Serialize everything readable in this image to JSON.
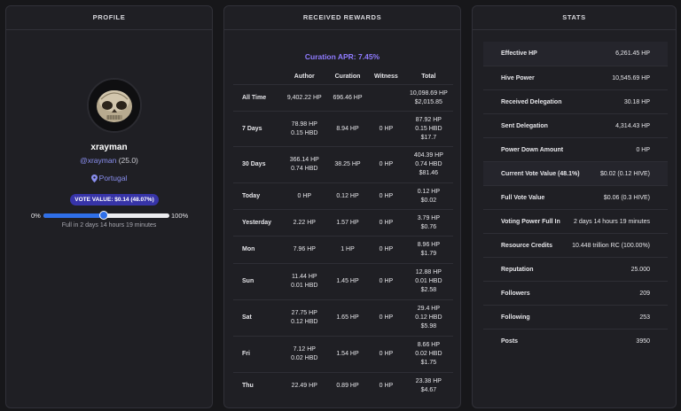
{
  "profile": {
    "header": "PROFILE",
    "username": "xrayman",
    "handle": "@xrayman",
    "reputation": "(25.0)",
    "location": "Portugal",
    "vote_value": "VOTE VALUE: $0.14 (48.07%)",
    "slider_min": "0%",
    "slider_max": "100%",
    "slider_fraction": 0.48,
    "full_in": "Full in 2 days 14 hours 19 minutes"
  },
  "rewards": {
    "header": "RECEIVED REWARDS",
    "curation_apr": "Curation APR: 7.45%",
    "columns": [
      "Author",
      "Curation",
      "Witness",
      "Total"
    ],
    "rows": [
      {
        "label": "All Time",
        "author": [
          "9,402.22 HP"
        ],
        "curation": "696.46 HP",
        "witness": "",
        "total": [
          "10,098.69 HP",
          "$2,015.85"
        ]
      },
      {
        "label": "7 Days",
        "author": [
          "78.98 HP",
          "0.15 HBD"
        ],
        "curation": "8.94 HP",
        "witness": "0 HP",
        "total": [
          "87.92 HP",
          "0.15 HBD",
          "$17.7"
        ]
      },
      {
        "label": "30 Days",
        "author": [
          "366.14 HP",
          "0.74 HBD"
        ],
        "curation": "38.25 HP",
        "witness": "0 HP",
        "total": [
          "404.39 HP",
          "0.74 HBD",
          "$81.46"
        ]
      },
      {
        "label": "Today",
        "author": [
          "0 HP"
        ],
        "curation": "0.12 HP",
        "witness": "0 HP",
        "total": [
          "0.12 HP",
          "$0.02"
        ]
      },
      {
        "label": "Yesterday",
        "author": [
          "2.22 HP"
        ],
        "curation": "1.57 HP",
        "witness": "0 HP",
        "total": [
          "3.79 HP",
          "$0.76"
        ]
      },
      {
        "label": "Mon",
        "author": [
          "7.96 HP"
        ],
        "curation": "1 HP",
        "witness": "0 HP",
        "total": [
          "8.96 HP",
          "$1.79"
        ]
      },
      {
        "label": "Sun",
        "author": [
          "11.44 HP",
          "0.01 HBD"
        ],
        "curation": "1.45 HP",
        "witness": "0 HP",
        "total": [
          "12.88 HP",
          "0.01 HBD",
          "$2.58"
        ]
      },
      {
        "label": "Sat",
        "author": [
          "27.75 HP",
          "0.12 HBD"
        ],
        "curation": "1.65 HP",
        "witness": "0 HP",
        "total": [
          "29.4 HP",
          "0.12 HBD",
          "$5.98"
        ]
      },
      {
        "label": "Fri",
        "author": [
          "7.12 HP",
          "0.02 HBD"
        ],
        "curation": "1.54 HP",
        "witness": "0 HP",
        "total": [
          "8.66 HP",
          "0.02 HBD",
          "$1.75"
        ]
      },
      {
        "label": "Thu",
        "author": [
          "22.49 HP"
        ],
        "curation": "0.89 HP",
        "witness": "0 HP",
        "total": [
          "23.38 HP",
          "$4.67"
        ]
      }
    ]
  },
  "stats": {
    "header": "STATS",
    "rows": [
      {
        "label": "Effective HP",
        "value": "6,261.45 HP",
        "highlight": true
      },
      {
        "label": "Hive Power",
        "value": "10,545.69 HP",
        "highlight": false
      },
      {
        "label": "Received Delegation",
        "value": "30.18 HP",
        "highlight": false
      },
      {
        "label": "Sent Delegation",
        "value": "4,314.43 HP",
        "highlight": false
      },
      {
        "label": "Power Down Amount",
        "value": "0 HP",
        "highlight": false
      },
      {
        "label": "Current Vote Value (48.1%)",
        "value": "$0.02 (0.12 HIVE)",
        "highlight": true
      },
      {
        "label": "Full Vote Value",
        "value": "$0.06 (0.3 HIVE)",
        "highlight": false
      },
      {
        "label": "Voting Power Full In",
        "value": "2 days 14 hours 19 minutes",
        "highlight": false
      },
      {
        "label": "Resource Credits",
        "value": "10.448 trillion RC (100.00%)",
        "highlight": false
      },
      {
        "label": "Reputation",
        "value": "25.000",
        "highlight": false
      },
      {
        "label": "Followers",
        "value": "209",
        "highlight": false
      },
      {
        "label": "Following",
        "value": "253",
        "highlight": false
      },
      {
        "label": "Posts",
        "value": "3950",
        "highlight": false
      }
    ]
  },
  "colors": {
    "accent": "#8a8ff0",
    "apr": "#8f7bff",
    "badge": "#3734a8",
    "slider": "#2f6fe8",
    "panel": "#1f1f24"
  }
}
